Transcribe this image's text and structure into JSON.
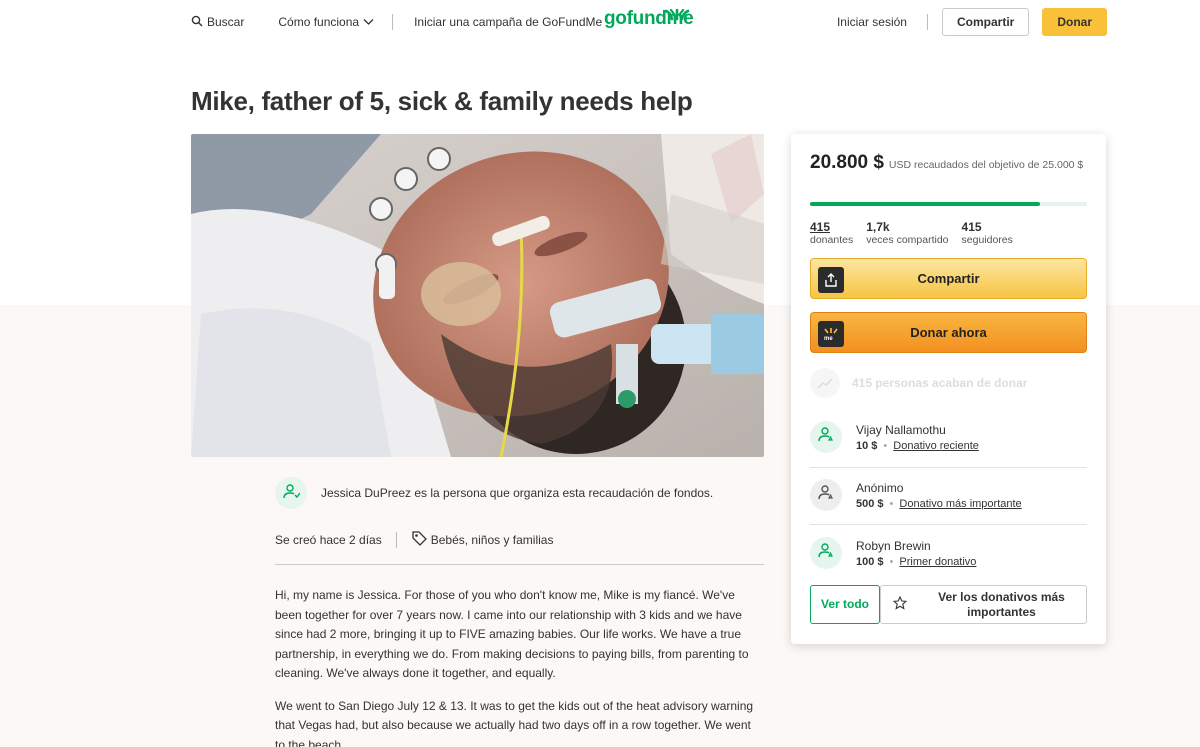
{
  "header": {
    "search_label": "Buscar",
    "how_it_works_label": "Cómo funciona",
    "start_campaign_label": "Iniciar una campaña de GoFundMe",
    "logo_text": "gofundme",
    "sign_in_label": "Iniciar sesión",
    "share_label": "Compartir",
    "donate_label": "Donar"
  },
  "campaign": {
    "title": "Mike, father of 5, sick & family needs help",
    "organizer_text": "Jessica DuPreez es la persona que organiza esta recaudación de fondos.",
    "created_text": "Se creó hace 2 días",
    "category": "Bebés, niños y familias",
    "story": [
      "Hi, my name is Jessica. For those of you who don't know me, Mike is my fiancé. We've been together for over 7 years now. I came into our relationship with 3 kids and we have since had 2 more, bringing it up to FIVE amazing babies. Our life works. We have a true partnership, in everything we do. From making decisions to paying bills, from parenting to cleaning. We've always done it together, and equally.",
      "We went to San Diego July 12 & 13. It was to get the kids out of the heat advisory warning that Vegas had, but also because we actually had two days off in a row together. We went to the beach."
    ]
  },
  "donation_card": {
    "raised_amount": "20.800 $",
    "raised_text": "USD recaudados del objetivo de 25.000 $",
    "progress_fraction": 0.832,
    "stats": [
      {
        "value": "415",
        "label": "donantes"
      },
      {
        "value": "1,7k",
        "label": "veces compartido"
      },
      {
        "value": "415",
        "label": "seguidores"
      }
    ],
    "share_button": "Compartir",
    "donate_button": "Donar ahora",
    "recent_activity": "415 personas acaban de donar",
    "donors": [
      {
        "name": "Vijay Nallamothu",
        "amount": "10 $",
        "tag": "Donativo reciente"
      },
      {
        "name": "Anónimo",
        "amount": "500 $",
        "tag": "Donativo más importante"
      },
      {
        "name": "Robyn Brewin",
        "amount": "100 $",
        "tag": "Primer donativo"
      }
    ],
    "see_all_label": "Ver todo",
    "see_top_label": "Ver los donativos más importantes"
  },
  "colors": {
    "brand_green": "#02a95c",
    "accent_yellow": "#f9c13a",
    "donate_orange": "#f29020"
  }
}
